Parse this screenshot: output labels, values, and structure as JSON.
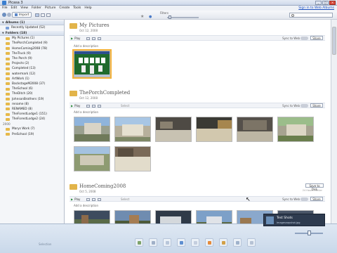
{
  "window": {
    "title": "Picasa 3",
    "controls": {
      "minimize": "_",
      "maximize": "□",
      "close": "×"
    }
  },
  "menubar": {
    "items": [
      "File",
      "Edit",
      "View",
      "Folder",
      "Picture",
      "Create",
      "Tools",
      "Help"
    ],
    "signin": "Sign in to Web Albums"
  },
  "toolbar": {
    "import_label": "Import",
    "filters_label": "Filters"
  },
  "sidebar": {
    "albums_header": "Albums (1)",
    "albums": [
      {
        "label": "Recently Updated (52)"
      }
    ],
    "folders_header": "Folders (18)",
    "folders": [
      {
        "label": "My Pictures (1)"
      },
      {
        "label": "ThePorchCompleted (9)"
      },
      {
        "label": "HomeComing2008 (78)"
      },
      {
        "label": "TheTruck (9)"
      },
      {
        "label": "The Porch (9)"
      },
      {
        "label": "Projects (2)"
      },
      {
        "label": "Completed (13)"
      },
      {
        "label": "watermark (12)"
      },
      {
        "label": "ArtWork (1)"
      },
      {
        "label": "BackstageM2008 (37)"
      },
      {
        "label": "TheSchool (6)"
      },
      {
        "label": "TheDitch (20)"
      },
      {
        "label": "JohnsonBrothers (19)"
      },
      {
        "label": "rename (8)"
      },
      {
        "label": "RENAMED (8)"
      },
      {
        "label": "TheForestLodge1 (151)"
      },
      {
        "label": "TheForestLodge2 (24)"
      }
    ],
    "year_label": "2000",
    "older": [
      {
        "label": "Marys Work (7)"
      },
      {
        "label": "PreSchool (19)"
      }
    ]
  },
  "sections": [
    {
      "title": "My Pictures",
      "date": "Oct 12, 2008",
      "play": "Play",
      "select": "",
      "sync": "Sync to Web",
      "share": "Share",
      "add_desc": "Add a description"
    },
    {
      "title": "ThePorchCompleted",
      "date": "Oct 12, 2008",
      "play": "Play",
      "select": "Select",
      "sync": "Sync to Web",
      "share": "Share",
      "add_desc": "Add a description"
    },
    {
      "title": "HomeComing2008",
      "date": "Oct 5, 2008",
      "play": "Play",
      "select": "Select",
      "sync": "Sync to Web",
      "share": "Share",
      "add_desc": "Add a description",
      "save_web": "Save to Disk",
      "save_web_sub": "24 Hours Earlier"
    }
  ],
  "bottom": {
    "tray_label": "Selection"
  },
  "toast": {
    "title": "Test Shots",
    "file": "Imagesnapshot.jpg"
  },
  "colors": {
    "accent": "#3a7fd0",
    "folder": "#e6b94a",
    "selection": "#f3b23a"
  }
}
